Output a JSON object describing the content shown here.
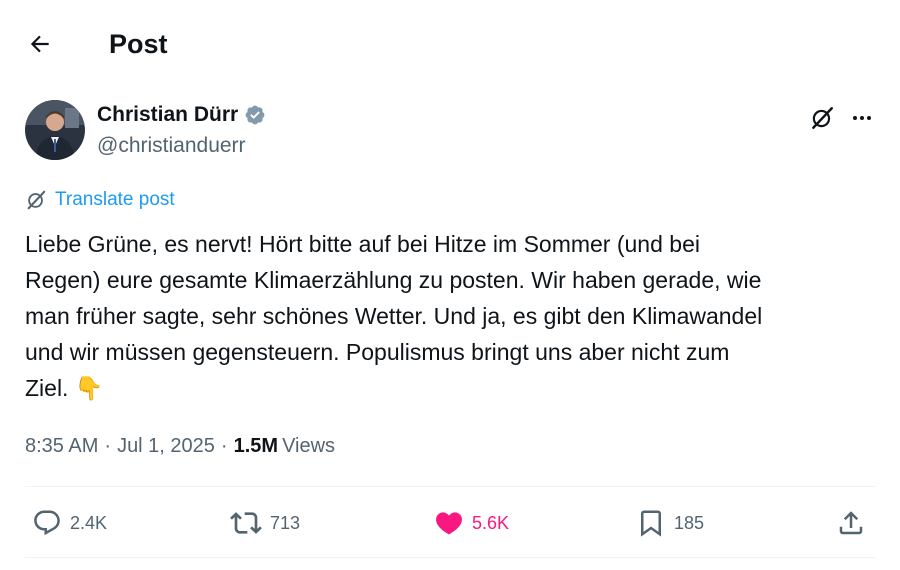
{
  "header": {
    "title": "Post"
  },
  "author": {
    "name": "Christian Dürr",
    "handle": "@christianduerr",
    "verified": true
  },
  "post": {
    "translate_label": "Translate post",
    "text": "Liebe Grüne, es nervt! Hört bitte auf bei Hitze im Sommer (und bei\nRegen) eure gesamte Klimaerzählung zu posten. Wir haben gerade, wie\nman früher sagte, sehr schönes Wetter. Und ja, es gibt den Klimawandel\nund wir müssen gegensteuern. Populismus bringt uns aber nicht zum\nZiel. 👇",
    "time": "8:35 AM",
    "date": "Jul 1, 2025",
    "views_count": "1.5M",
    "views_label": "Views"
  },
  "actions": {
    "replies": "2.4K",
    "reposts": "713",
    "likes": "5.6K",
    "bookmarks": "185"
  },
  "colors": {
    "accent": "#1d9bf0",
    "like": "#f91880",
    "muted": "#536471",
    "text": "#0f1419",
    "verified_badge": "#829aab"
  },
  "icons": {
    "back": "arrow-left-icon",
    "verified": "verified-badge-icon",
    "grok": "grok-icon",
    "more": "more-horizontal-icon",
    "translate": "translate-icon",
    "reply": "reply-icon",
    "repost": "repost-icon",
    "like": "heart-icon",
    "bookmark": "bookmark-icon",
    "share": "share-icon"
  }
}
